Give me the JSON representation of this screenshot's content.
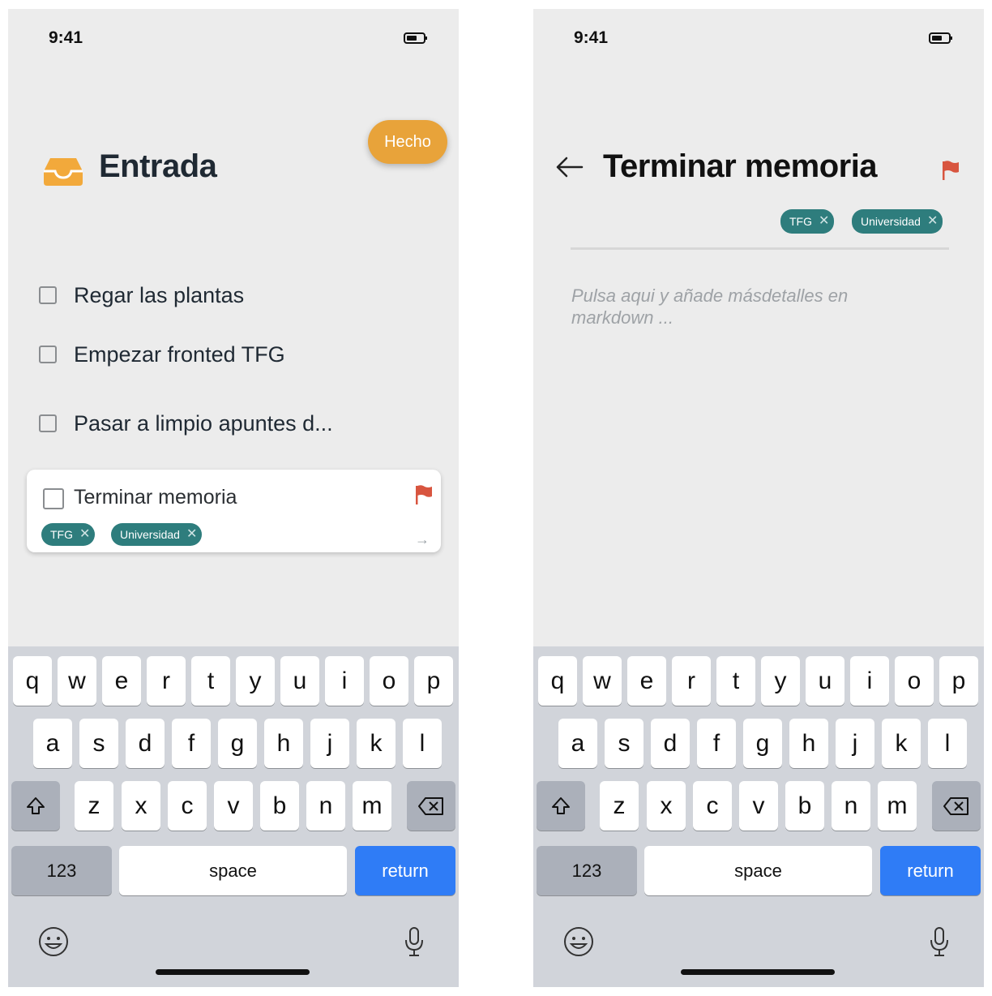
{
  "status": {
    "time": "9:41"
  },
  "inbox": {
    "done_button": "Hecho",
    "title": "Entrada",
    "tasks": [
      {
        "label": "Regar las plantas"
      },
      {
        "label": "Empezar fronted TFG"
      },
      {
        "label": "Pasar a limpio apuntes d..."
      }
    ],
    "editing_card": {
      "title": "Terminar memoria",
      "tags": [
        {
          "label": "TFG"
        },
        {
          "label": "Universidad"
        }
      ],
      "arrow": "→"
    }
  },
  "detail": {
    "title": "Terminar memoria",
    "tags": [
      {
        "label": "TFG"
      },
      {
        "label": "Universidad"
      }
    ],
    "notes_placeholder": "Pulsa aqui y añade másdetalles en markdown ..."
  },
  "keyboard": {
    "row1": [
      "q",
      "w",
      "e",
      "r",
      "t",
      "y",
      "u",
      "i",
      "o",
      "p"
    ],
    "row2": [
      "a",
      "s",
      "d",
      "f",
      "g",
      "h",
      "j",
      "k",
      "l"
    ],
    "row3": [
      "z",
      "x",
      "c",
      "v",
      "b",
      "n",
      "m"
    ],
    "numbers_label": "123",
    "space_label": "space",
    "return_label": "return"
  },
  "colors": {
    "accent": "#e8a33a",
    "tag": "#2e7d7d",
    "flag": "#d8553f",
    "return_key": "#2f7cf6"
  },
  "icons": [
    "inbox-icon",
    "battery-icon",
    "flag-icon",
    "back-arrow-icon",
    "shift-icon",
    "backspace-icon",
    "emoji-icon",
    "microphone-icon"
  ]
}
